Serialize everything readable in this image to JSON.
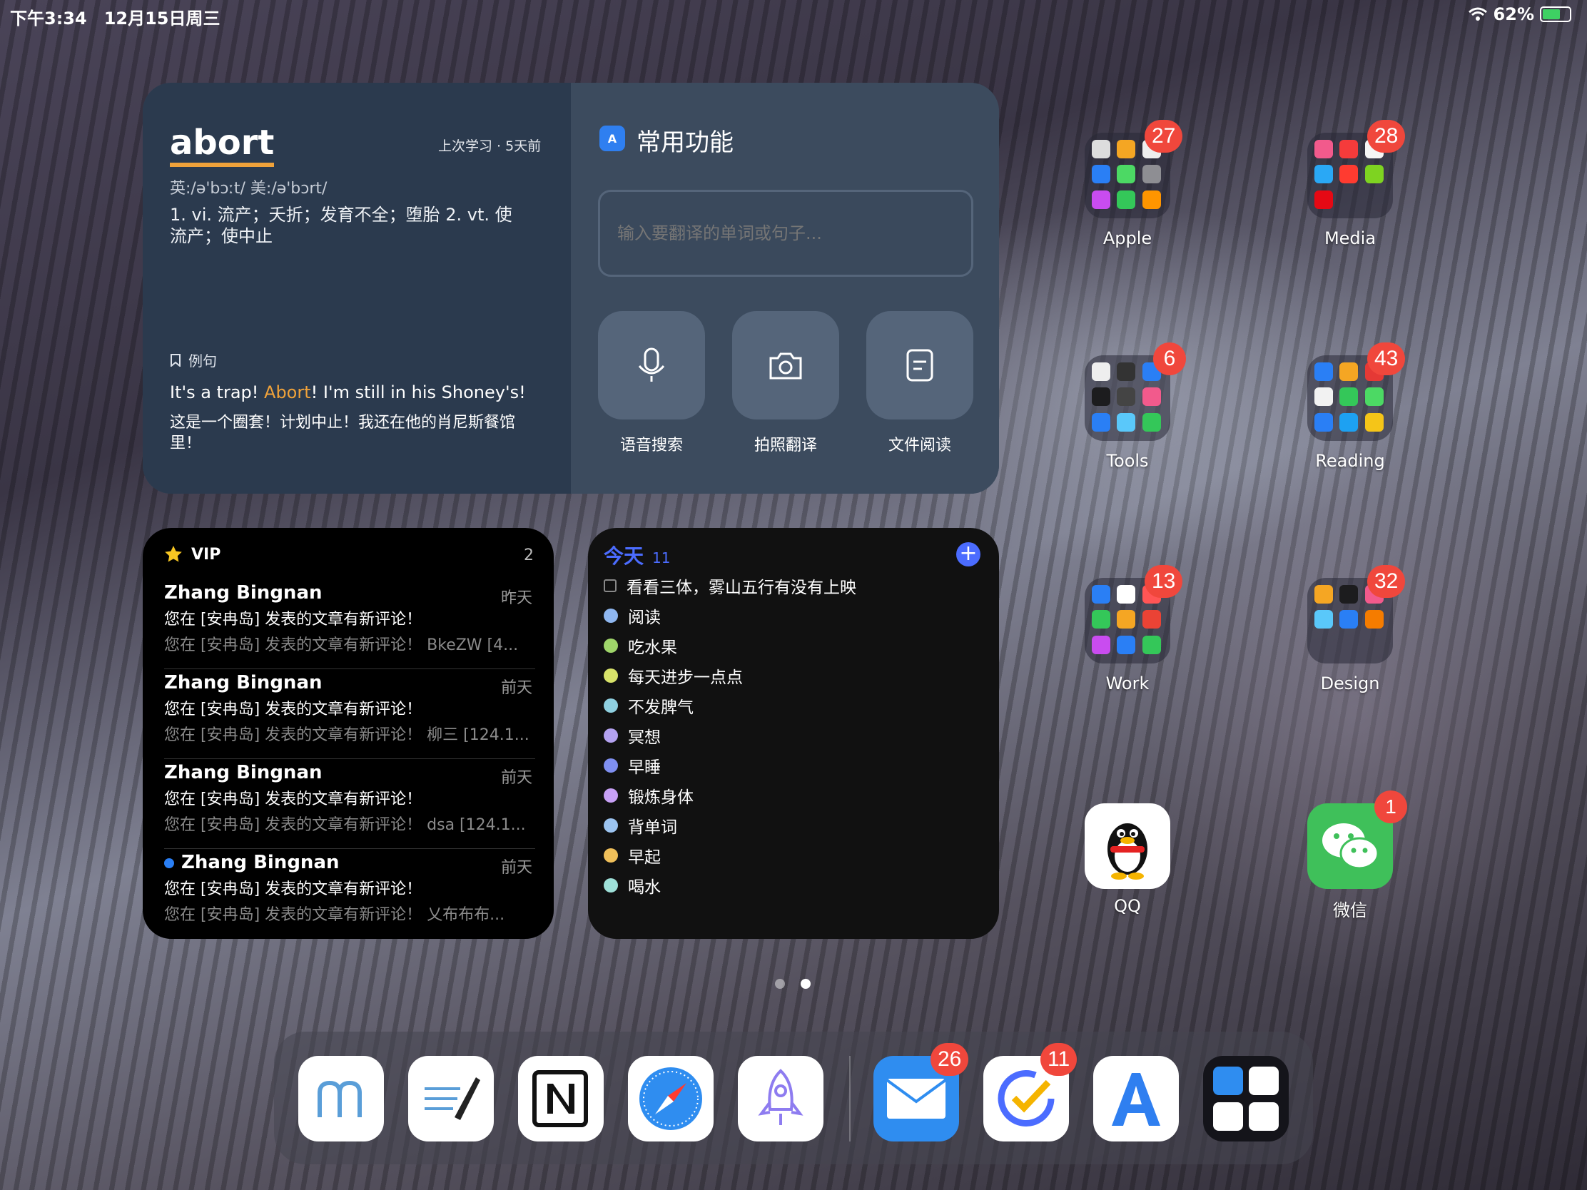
{
  "status": {
    "time": "下午3:34",
    "date": "12月15日周三",
    "battery": "62%",
    "battery_level": 0.62
  },
  "dict": {
    "word": "abort",
    "last_studied": "上次学习 · 5天前",
    "phonetic": "英:/ə'bɔːt/    美:/ə'bɔrt/",
    "definition": "1. vi. 流产；夭折；发育不全；堕胎  2. vt. 使流产；使中止",
    "example_heading": "例句",
    "example_en_pre": "It's a trap! ",
    "example_en_hl": "Abort",
    "example_en_post": "! I'm still in his Shoney's!",
    "example_zh": "这是一个圈套！计划中止！我还在他的肖尼斯餐馆里！",
    "func_title": "常用功能",
    "input_placeholder": "输入要翻译的单词或句子...",
    "buttons": [
      "语音搜索",
      "拍照翻译",
      "文件阅读"
    ],
    "colors": {
      "accent": "#f0a23a"
    }
  },
  "mail": {
    "title": "VIP",
    "count": "2",
    "messages": [
      {
        "from": "Zhang Bingnan",
        "when": "昨天",
        "subject": "您在 [安冉岛] 发表的文章有新评论！",
        "preview": "您在 [安冉岛] 发表的文章有新评论！ BkeZW [4..."
      },
      {
        "from": "Zhang Bingnan",
        "when": "前天",
        "subject": "您在 [安冉岛] 发表的文章有新评论！",
        "preview": "您在 [安冉岛] 发表的文章有新评论！ 柳三 [124.1..."
      },
      {
        "from": "Zhang Bingnan",
        "when": "前天",
        "subject": "您在 [安冉岛] 发表的文章有新评论！",
        "preview": "您在 [安冉岛] 发表的文章有新评论！ dsa [124.1..."
      },
      {
        "from": "Zhang Bingnan",
        "when": "前天",
        "subject": "您在 [安冉岛] 发表的文章有新评论！",
        "preview": "您在 [安冉岛] 发表的文章有新评论！ 乂布布布..."
      }
    ]
  },
  "todo": {
    "title": "今天",
    "count": "11",
    "items": [
      "看看三体，雾山五行有没有上映",
      "阅读",
      "吃水果",
      "每天进步一点点",
      "不发脾气",
      "冥想",
      "早睡",
      "锻炼身体",
      "背单词",
      "早起",
      "喝水"
    ]
  },
  "folders": [
    {
      "label": "Apple",
      "badge": "27"
    },
    {
      "label": "Media",
      "badge": "28"
    },
    {
      "label": "Tools",
      "badge": "6"
    },
    {
      "label": "Reading",
      "badge": "43"
    },
    {
      "label": "Work",
      "badge": "13"
    },
    {
      "label": "Design",
      "badge": "32"
    }
  ],
  "apps": [
    {
      "label": "QQ",
      "badge": ""
    },
    {
      "label": "微信",
      "badge": "1"
    }
  ],
  "dock": {
    "mail_badge": "26",
    "tasks_badge": "11"
  },
  "page": {
    "pages": 2,
    "current": 2
  }
}
